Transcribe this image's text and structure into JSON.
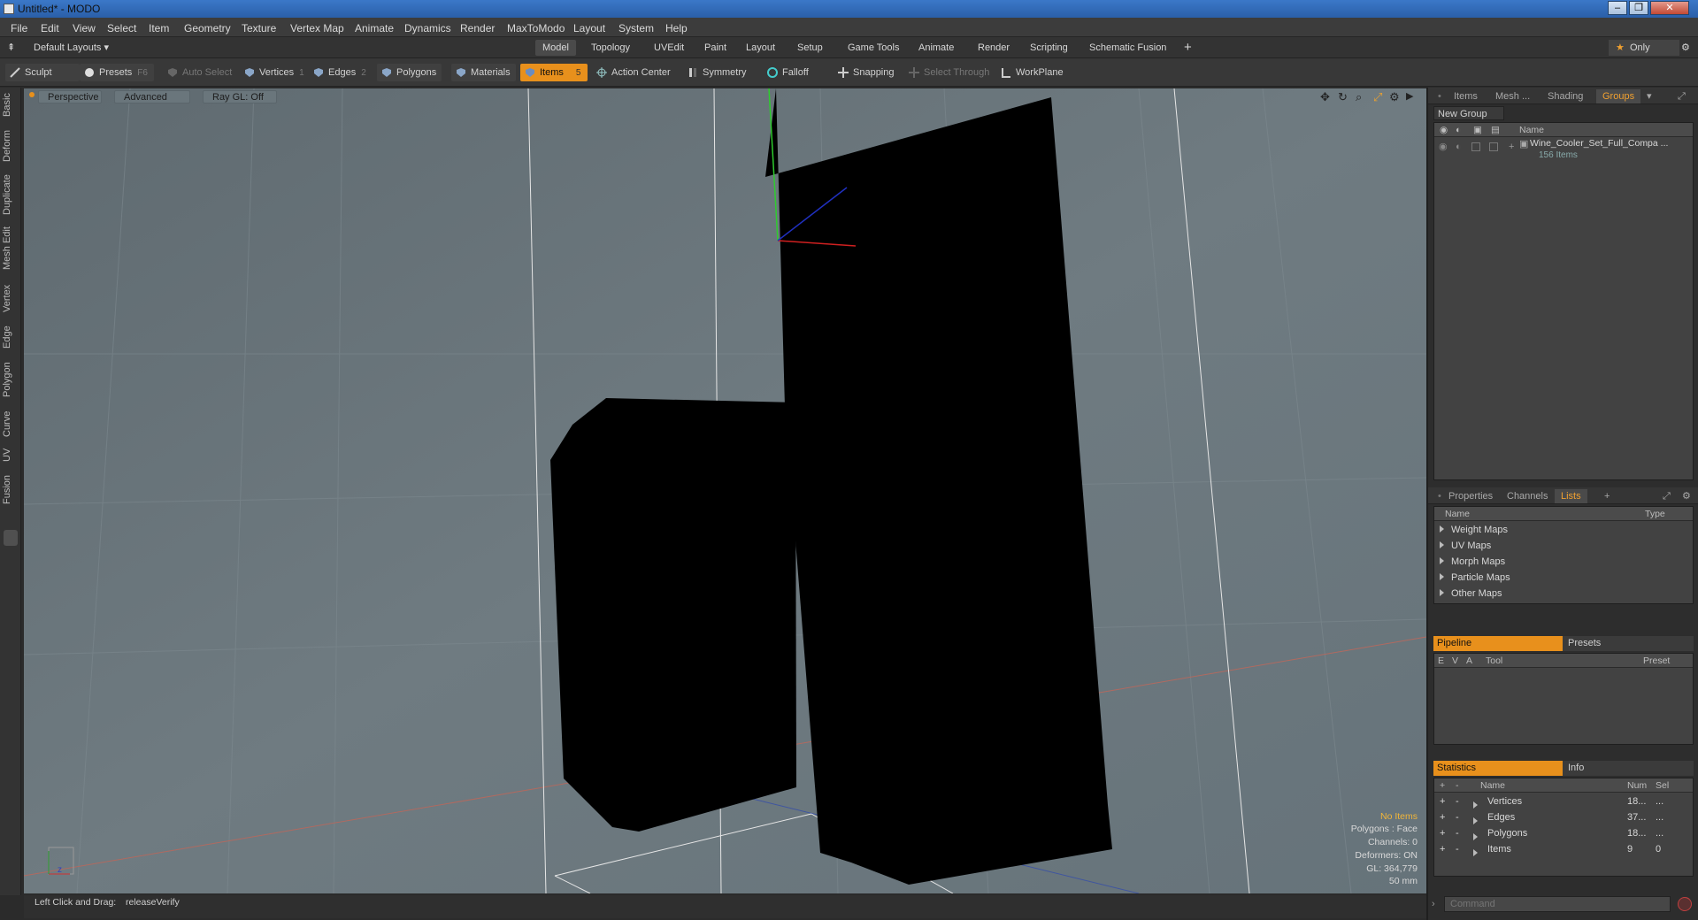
{
  "window": {
    "title": "Untitled* - MODO"
  },
  "menu": [
    "File",
    "Edit",
    "View",
    "Select",
    "Item",
    "Geometry",
    "Texture",
    "Vertex Map",
    "Animate",
    "Dynamics",
    "Render",
    "MaxToModo",
    "Layout",
    "System",
    "Help"
  ],
  "layoutbar": {
    "layouts_label": "Default Layouts",
    "tabs": [
      "Model",
      "Topology",
      "UVEdit",
      "Paint",
      "Layout",
      "Setup",
      "Game Tools",
      "Animate",
      "Render",
      "Scripting",
      "Schematic Fusion"
    ],
    "active_tab": "Model",
    "only_label": "Only"
  },
  "toolbar": {
    "sculpt": "Sculpt",
    "presets": "Presets",
    "presets_key": "F6",
    "auto_select": "Auto Select",
    "vertices": "Vertices",
    "vertices_key": "1",
    "edges": "Edges",
    "edges_key": "2",
    "polygons": "Polygons",
    "materials": "Materials",
    "items": "Items",
    "items_key": "5",
    "action_center": "Action Center",
    "symmetry": "Symmetry",
    "falloff": "Falloff",
    "snapping": "Snapping",
    "select_through": "Select Through",
    "workplane": "WorkPlane"
  },
  "left_tabs": [
    "Basic",
    "Deform",
    "Duplicate",
    "Mesh Edit",
    "Vertex",
    "Edge",
    "Polygon",
    "Curve",
    "UV",
    "Fusion"
  ],
  "viewport": {
    "perspective": "Perspective",
    "advanced": "Advanced",
    "raygl": "Ray GL: Off",
    "stats": {
      "no_items": "No Items",
      "polygons": "Polygons : Face",
      "channels": "Channels: 0",
      "deformers": "Deformers: ON",
      "gl": "GL: 364,779",
      "scale": "50 mm"
    }
  },
  "status": {
    "left_click": "Left Click and Drag:",
    "command": "releaseVerify"
  },
  "groups_panel": {
    "tabs": [
      "Items",
      "Mesh ...",
      "Shading",
      "Groups"
    ],
    "active_tab": "Groups",
    "new_group": "New Group",
    "name_col": "Name",
    "group_name": "Wine_Cooler_Set_Full_Compa ...",
    "group_count": "156 Items"
  },
  "lists_panel": {
    "tabs": [
      "Properties",
      "Channels",
      "Lists"
    ],
    "active_tab": "Lists",
    "name_col": "Name",
    "type_col": "Type",
    "items": [
      "Weight Maps",
      "UV Maps",
      "Morph Maps",
      "Particle Maps",
      "Other Maps"
    ]
  },
  "pipeline_panel": {
    "pipeline": "Pipeline",
    "presets": "Presets",
    "cols": {
      "e": "E",
      "v": "V",
      "a": "A",
      "tool": "Tool",
      "preset": "Preset"
    }
  },
  "stats_panel": {
    "statistics": "Statistics",
    "info": "Info",
    "cols": {
      "name": "Name",
      "num": "Num",
      "sel": "Sel"
    },
    "rows": [
      {
        "name": "Vertices",
        "num": "18...",
        "sel": "..."
      },
      {
        "name": "Edges",
        "num": "37...",
        "sel": "..."
      },
      {
        "name": "Polygons",
        "num": "18...",
        "sel": "..."
      },
      {
        "name": "Items",
        "num": "9",
        "sel": "0"
      }
    ]
  },
  "command": {
    "placeholder": "Command"
  },
  "colors": {
    "accent": "#e8901c",
    "viewport_bg": "#6e7a80"
  }
}
